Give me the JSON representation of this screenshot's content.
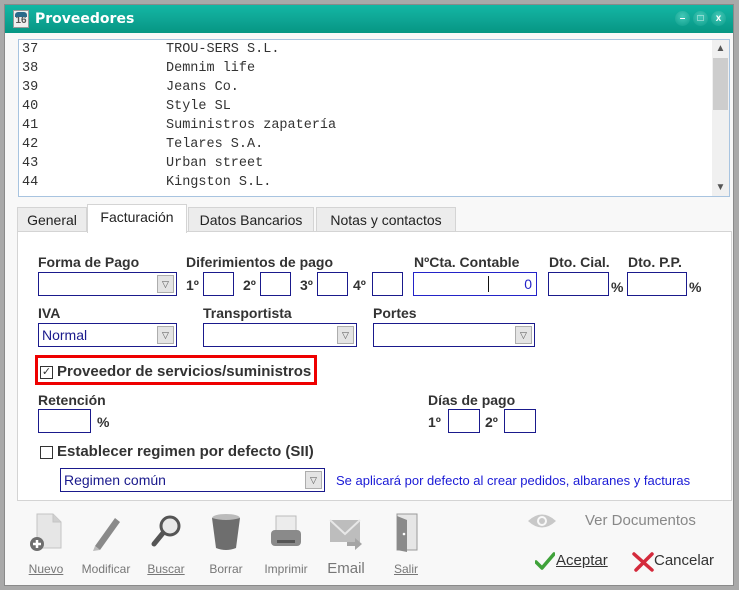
{
  "window": {
    "title": "Proveedores",
    "icon_text": "16",
    "controls": [
      "minimize",
      "maximize",
      "close"
    ]
  },
  "supplier_list": {
    "rows": [
      {
        "code": "37",
        "name": "TROU-SERS S.L."
      },
      {
        "code": "38",
        "name": "Demnim life"
      },
      {
        "code": "39",
        "name": "Jeans Co."
      },
      {
        "code": "40",
        "name": "Style SL"
      },
      {
        "code": "41",
        "name": "Suministros zapatería"
      },
      {
        "code": "42",
        "name": "Telares S.A."
      },
      {
        "code": "43",
        "name": "Urban street"
      },
      {
        "code": "44",
        "name": "Kingston S.L."
      }
    ]
  },
  "tabs": [
    {
      "label": "General",
      "accel": "G",
      "active": false
    },
    {
      "label": "Facturación",
      "accel": "F",
      "active": true
    },
    {
      "label": "Datos Bancarios",
      "active": false
    },
    {
      "label": "Notas y contactos",
      "accel": "t",
      "active": false
    }
  ],
  "form": {
    "forma_pago": {
      "label": "Forma de Pago",
      "value": ""
    },
    "diferimientos": {
      "label": "Diferimientos de pago",
      "ordinals": [
        "1º",
        "2º",
        "3º",
        "4º"
      ],
      "values": [
        "",
        "",
        "",
        ""
      ]
    },
    "cuenta_contable": {
      "label": "NºCta. Contable",
      "value": "0"
    },
    "dto_cial": {
      "label": "Dto. Cial.",
      "value": "",
      "unit": "%"
    },
    "dto_pp": {
      "label": "Dto. P.P.",
      "value": "",
      "unit": "%"
    },
    "iva": {
      "label": "IVA",
      "value": "Normal"
    },
    "transportista": {
      "label": "Transportista",
      "value": ""
    },
    "portes": {
      "label": "Portes",
      "value": ""
    },
    "proveedor_servicios": {
      "label": "Proveedor de servicios/suministros",
      "checked": true
    },
    "retencion": {
      "label": "Retención",
      "value": "",
      "unit": "%"
    },
    "dias_pago": {
      "label": "Días de pago",
      "ordinals": [
        "1º",
        "2º"
      ],
      "values": [
        "",
        ""
      ]
    },
    "regimen_defecto": {
      "label": "Establecer regimen por defecto (SII)",
      "checked": false
    },
    "regimen": {
      "value": "Regimen común"
    },
    "regimen_info": "Se aplicará por defecto al crear pedidos, albaranes y facturas"
  },
  "toolbar": [
    {
      "label": "Nuevo",
      "icon": "new-document-icon"
    },
    {
      "label": "Modificar",
      "icon": "pen-icon"
    },
    {
      "label": "Buscar",
      "icon": "magnifier-icon"
    },
    {
      "label": "Borrar",
      "icon": "trash-icon"
    },
    {
      "label": "Imprimir",
      "icon": "printer-icon"
    },
    {
      "label": "Email",
      "icon": "email-icon"
    },
    {
      "label": "Salir",
      "icon": "door-icon"
    }
  ],
  "actions": {
    "ver_documentos": "Ver Documentos",
    "aceptar": "Aceptar",
    "cancelar": "Cancelar"
  },
  "colors": {
    "titlebar": "#0ea493",
    "field_border": "#1a1a8c",
    "highlight": "#ee0000",
    "info_text": "#1a1ad6"
  }
}
